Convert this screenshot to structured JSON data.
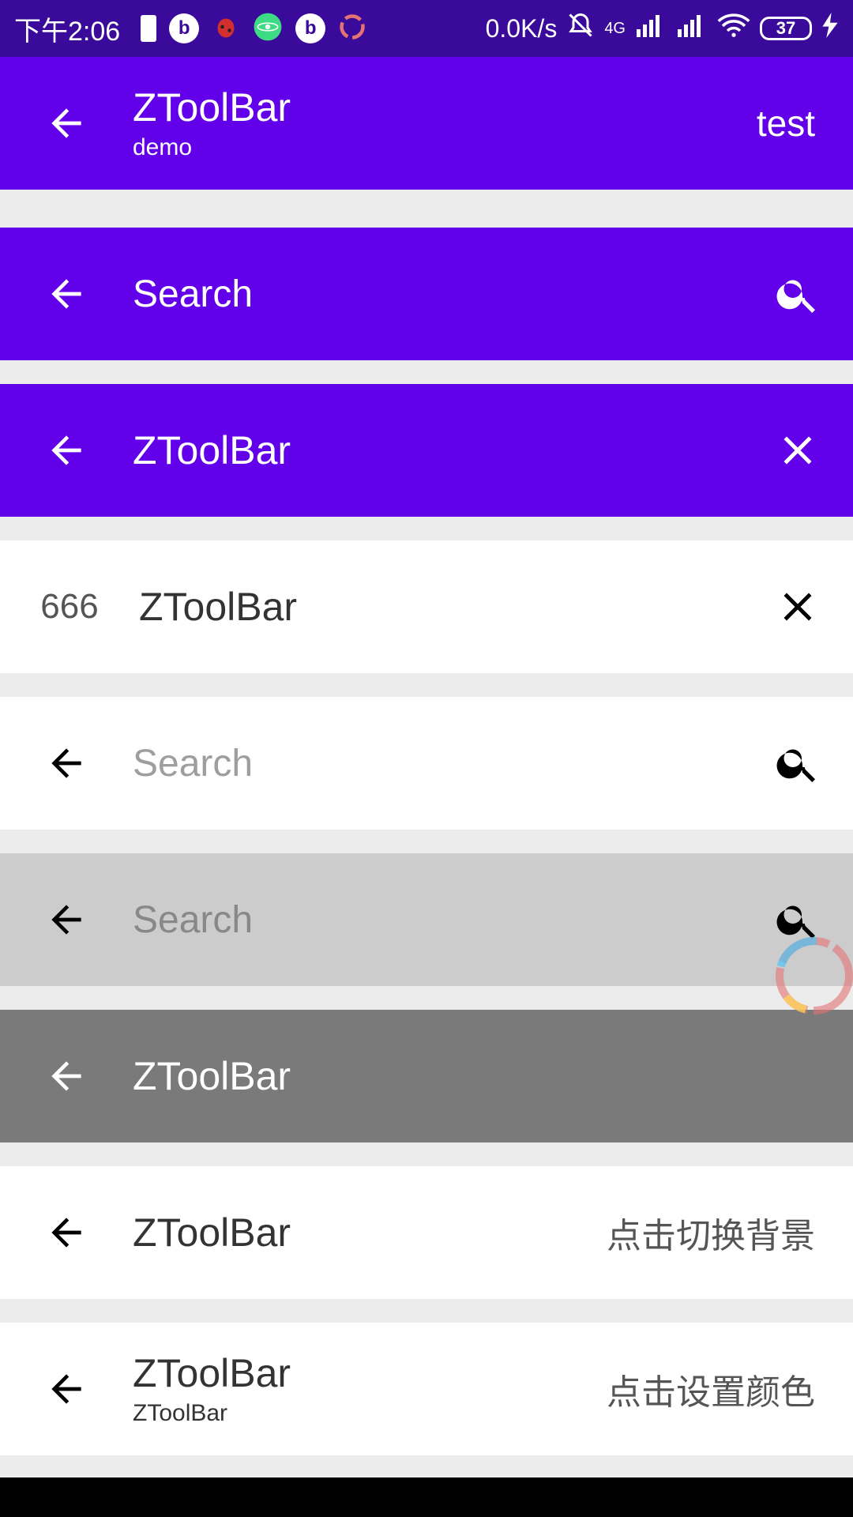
{
  "status_bar": {
    "time": "下午2:06",
    "network_speed": "0.0K/s",
    "network_type": "4G",
    "battery_level": "37",
    "icons": [
      "battery-icon",
      "app-icon",
      "bug-icon",
      "atom-icon",
      "app-icon",
      "ring-icon",
      "mute-bell-icon",
      "signal-icon",
      "signal-icon",
      "wifi-icon",
      "charging-icon"
    ]
  },
  "toolbars": {
    "t1": {
      "title": "ZToolBar",
      "subtitle": "demo",
      "action_text": "test"
    },
    "t2": {
      "placeholder": "Search"
    },
    "t3": {
      "title": "ZToolBar"
    },
    "t4": {
      "nav_text": "666",
      "title": "ZToolBar"
    },
    "t5": {
      "placeholder": "Search"
    },
    "t6": {
      "placeholder": "Search"
    },
    "t7": {
      "title": "ZToolBar"
    },
    "t8": {
      "title": "ZToolBar",
      "action_text": "点击切换背景"
    },
    "t9": {
      "title": "ZToolBar",
      "subtitle": "ZToolBar",
      "action_text": "点击设置颜色"
    }
  },
  "colors": {
    "primary": "#6200ea",
    "status_bar": "#3a0a9a",
    "light_gray_bar": "#cccccc",
    "dark_gray_bar": "#7a7a7a",
    "background": "#ececec"
  }
}
